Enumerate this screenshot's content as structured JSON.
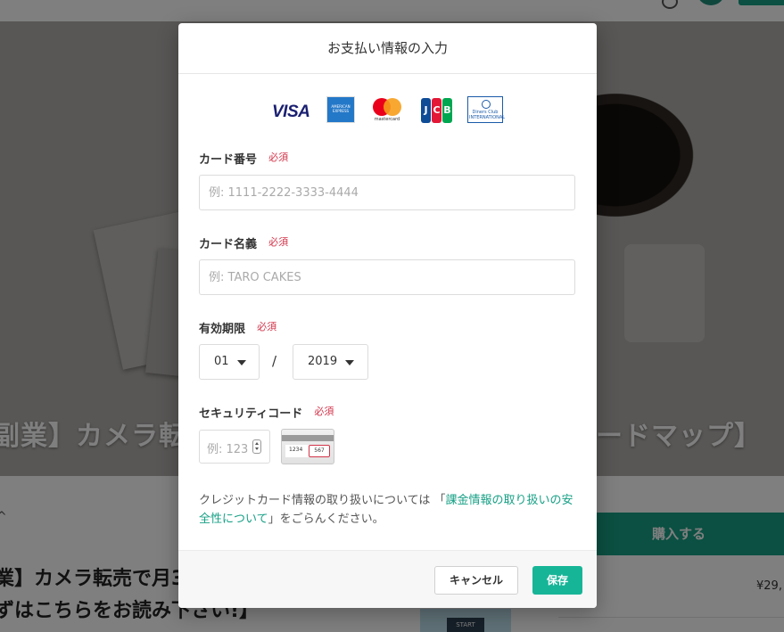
{
  "background": {
    "hero_title_left": "副業】カメラ転",
    "hero_title_right": "ードマップ】 ",
    "chevron": "^",
    "article_title_line1": "業】カメラ転売で月3",
    "article_title_line2": "ずはこちらをお読み下さい!】",
    "thumb_label": "START",
    "buy_button": "購入する",
    "price": "¥29,"
  },
  "modal": {
    "title": "お支払い情報の入力",
    "brands": {
      "visa": "VISA",
      "amex": "AMERICAN EXPRESS",
      "mastercard": "mastercard",
      "jcb": [
        "J",
        "C",
        "B"
      ],
      "diners": "Diners Club INTERNATIONAL"
    },
    "required_label": "必須",
    "card_number": {
      "label": "カード番号",
      "placeholder": "例: 1111-2222-3333-4444",
      "value": ""
    },
    "card_name": {
      "label": "カード名義",
      "placeholder": "例: TARO CAKES",
      "value": ""
    },
    "expiry": {
      "label": "有効期限",
      "month": "01",
      "separator": "/",
      "year": "2019"
    },
    "security_code": {
      "label": "セキュリティコード",
      "placeholder": "例: 123",
      "card_number_sample": "1234",
      "cvc_sample": "567"
    },
    "note": {
      "before": "クレジットカード情報の取り扱いについては 「",
      "link": "課金情報の取り扱いの安全性について",
      "after": "」をごらんください。"
    },
    "cancel_button": "キャンセル",
    "save_button": "保存"
  }
}
